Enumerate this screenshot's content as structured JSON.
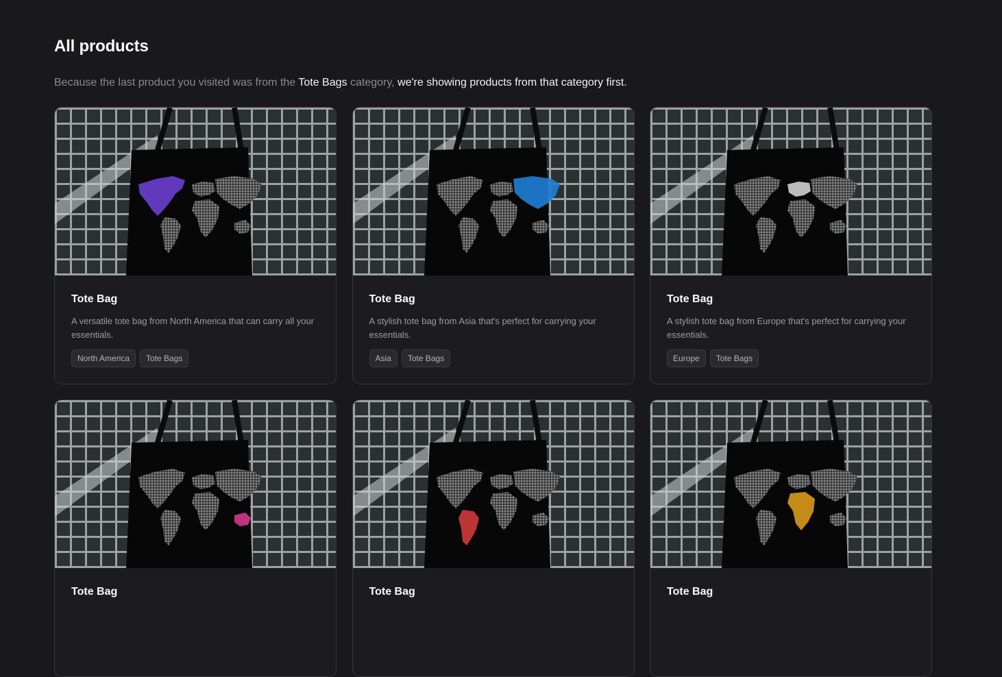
{
  "page": {
    "title": "All products",
    "subtitle": {
      "prefix": "Because the last product you visited was from the ",
      "category": "Tote Bags",
      "middle": " category, ",
      "suffix": "we're showing products from that category first."
    }
  },
  "products": [
    {
      "title": "Tote Bag",
      "description": "A versatile tote bag from North America that can carry all your essentials.",
      "tags": [
        "North America",
        "Tote Bags"
      ],
      "highlight_region": "north-america",
      "highlight_color": "#6b3fd0"
    },
    {
      "title": "Tote Bag",
      "description": "A stylish tote bag from Asia that's perfect for carrying your essentials.",
      "tags": [
        "Asia",
        "Tote Bags"
      ],
      "highlight_region": "asia",
      "highlight_color": "#1e7fd6"
    },
    {
      "title": "Tote Bag",
      "description": "A stylish tote bag from Europe that's perfect for carrying your essentials.",
      "tags": [
        "Europe",
        "Tote Bags"
      ],
      "highlight_region": "europe",
      "highlight_color": "#d0d0d0"
    },
    {
      "title": "Tote Bag",
      "description": "",
      "tags": [],
      "highlight_region": "oceania",
      "highlight_color": "#d03a8c"
    },
    {
      "title": "Tote Bag",
      "description": "",
      "tags": [],
      "highlight_region": "south-america",
      "highlight_color": "#d33a3a"
    },
    {
      "title": "Tote Bag",
      "description": "",
      "tags": [],
      "highlight_region": "africa",
      "highlight_color": "#d99a1c"
    }
  ]
}
